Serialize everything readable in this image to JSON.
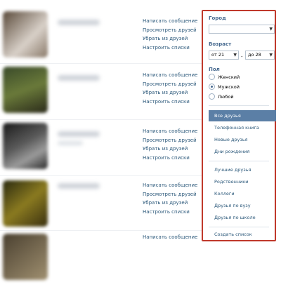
{
  "friends": [
    {
      "actions": [
        "Написать сообщение",
        "Просмотреть друзей",
        "Убрать из друзей",
        "Настроить списки"
      ]
    },
    {
      "actions": [
        "Написать сообщение",
        "Просмотреть друзей",
        "Убрать из друзей",
        "Настроить списки"
      ]
    },
    {
      "actions": [
        "Написать сообщение",
        "Просмотреть друзей",
        "Убрать из друзей",
        "Настроить списки"
      ]
    },
    {
      "actions": [
        "Написать сообщение",
        "Просмотреть друзей",
        "Убрать из друзей",
        "Настроить списки"
      ]
    },
    {
      "actions": [
        "Написать сообщение"
      ]
    }
  ],
  "filter": {
    "city": {
      "title": "Город",
      "value": ""
    },
    "age": {
      "title": "Возраст",
      "from": "от 21",
      "to": "до 28"
    },
    "gender": {
      "title": "Пол",
      "options": [
        "Женский",
        "Мужской",
        "Любой"
      ],
      "selected": "Мужской"
    }
  },
  "lists": {
    "primary": [
      "Все друзья",
      "Телефонная книга",
      "Новые друзья",
      "Дни рождения"
    ],
    "active": "Все друзья",
    "secondary": [
      "Лучшие друзья",
      "Родственники",
      "Коллеги",
      "Друзья по вузу",
      "Друзья по школе"
    ],
    "create": "Создать список"
  },
  "colors": {
    "accent": "#5b7fa6",
    "link": "#2b587a",
    "highlight_border": "#c0392b"
  }
}
